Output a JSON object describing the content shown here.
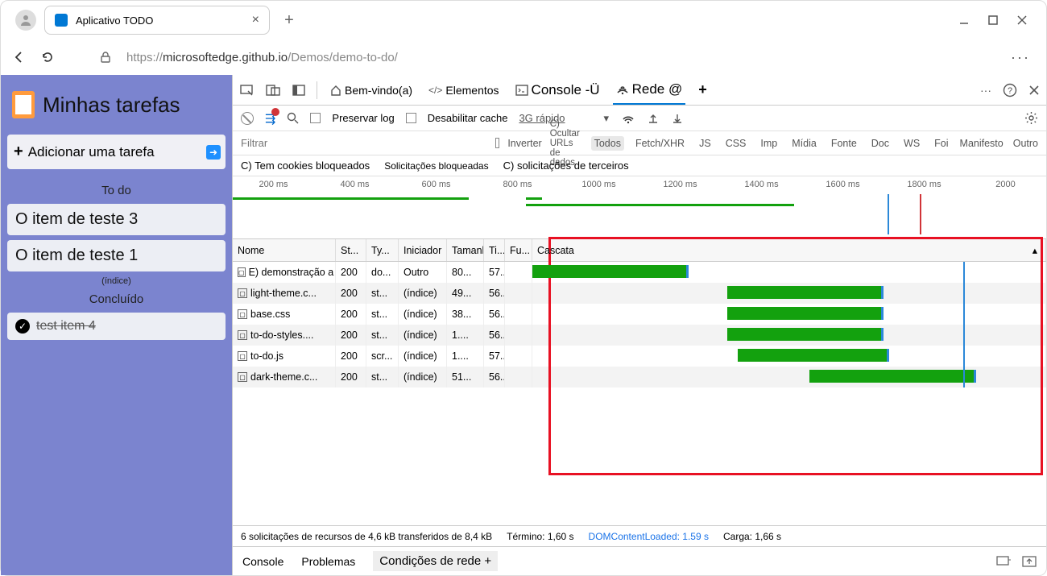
{
  "browser": {
    "tab_title": "Aplicativo TODO",
    "url_prefix": "https://",
    "url_host": "microsoftedge.github.io",
    "url_path": "/Demos/demo-to-do/"
  },
  "app": {
    "title": "Minhas tarefas",
    "add_task": "Adicionar uma tarefa",
    "section_todo": "To do",
    "section_index": "(índice)",
    "section_done": "Concluído",
    "tasks_todo": [
      "O item de teste 3",
      "O item de teste 1"
    ],
    "tasks_done": [
      "test item 4"
    ]
  },
  "devtools": {
    "tabs": {
      "welcome": "Bem-vindo(a)",
      "elements": "Elementos",
      "console": "Console -Ü",
      "network": "Rede @",
      "plus": "+"
    },
    "toolbar": {
      "preserve": "Preservar log",
      "disable_cache": "Desabilitar cache",
      "throttling": "3G rápido"
    },
    "filters": {
      "placeholder": "Filtrar",
      "invert": "Inverter",
      "hide_data": "C) Ocultar URLs de dados",
      "pills": [
        "Todos",
        "Fetch/XHR",
        "JS",
        "CSS",
        "Imp",
        "Mídia",
        "Fonte",
        "Doc",
        "WS",
        "Foi"
      ],
      "manifest": "Manifesto",
      "other": "Outro"
    },
    "filters2": {
      "cookies": "C) Tem cookies bloqueados",
      "blocked": "Solicitações bloqueadas",
      "thirdparty": "C) solicitações de terceiros"
    },
    "timeline_ticks": [
      "200 ms",
      "400 ms",
      "600 ms",
      "800 ms",
      "1000 ms",
      "1200 ms",
      "1400 ms",
      "1600 ms",
      "1800 ms",
      "2000"
    ],
    "columns": {
      "name": "Nome",
      "status": "St...",
      "type": "Ty...",
      "initiator": "Iniciador",
      "size": "Tamanh...",
      "time": "Ti...",
      "fu": "Fu...",
      "waterfall": "Cascata"
    },
    "rows": [
      {
        "name": "E) demonstração a fazer/",
        "st": "200",
        "ty": "do...",
        "ini": "Outro",
        "tam": "80...",
        "ti": "57...",
        "fu": "",
        "bar": {
          "left": 0,
          "width": 30
        }
      },
      {
        "name": "light-theme.c...",
        "st": "200",
        "ty": "st...",
        "ini": "(índice)",
        "tam": "49...",
        "ti": "56...",
        "fu": "",
        "bar": {
          "left": 38,
          "width": 30
        }
      },
      {
        "name": "base.css",
        "st": "200",
        "ty": "st...",
        "ini": "(índice)",
        "tam": "38...",
        "ti": "56...",
        "fu": "",
        "bar": {
          "left": 38,
          "width": 30
        }
      },
      {
        "name": "to-do-styles....",
        "st": "200",
        "ty": "st...",
        "ini": "(índice)",
        "tam": "1....",
        "ti": "56...",
        "fu": "",
        "bar": {
          "left": 38,
          "width": 30
        }
      },
      {
        "name": "to-do.js",
        "st": "200",
        "ty": "scr...",
        "ini": "(índice)",
        "tam": "1....",
        "ti": "57...",
        "fu": "",
        "bar": {
          "left": 40,
          "width": 29
        }
      },
      {
        "name": "dark-theme.c...",
        "st": "200",
        "ty": "st...",
        "ini": "(índice)",
        "tam": "51...",
        "ti": "56...",
        "fu": "",
        "bar": {
          "left": 54,
          "width": 32
        }
      }
    ],
    "status": {
      "summary": "6 solicitações de recursos de 4,6 kB transferidos de 8,4 kB",
      "finish": "Término: 1,60 s",
      "dcl": "DOMContentLoaded: 1.59 s",
      "load": "Carga: 1,66 s"
    },
    "drawer": {
      "console": "Console",
      "problems": "Problemas",
      "netcond": "Condições de rede +"
    }
  },
  "chart_data": {
    "type": "waterfall",
    "x_unit": "ms",
    "x_range": [
      0,
      2000
    ],
    "ticks": [
      200,
      400,
      600,
      800,
      1000,
      1200,
      1400,
      1600,
      1800,
      2000
    ],
    "markers": {
      "DOMContentLoaded": 1590,
      "Load": 1660,
      "Finish": 1600
    },
    "series": [
      {
        "name": "demonstração a fazer/",
        "start": 0,
        "end": 570
      },
      {
        "name": "light-theme.css",
        "start": 590,
        "end": 1150
      },
      {
        "name": "base.css",
        "start": 590,
        "end": 1150
      },
      {
        "name": "to-do-styles.css",
        "start": 590,
        "end": 1150
      },
      {
        "name": "to-do.js",
        "start": 610,
        "end": 1160
      },
      {
        "name": "dark-theme.css",
        "start": 820,
        "end": 1380
      }
    ]
  }
}
